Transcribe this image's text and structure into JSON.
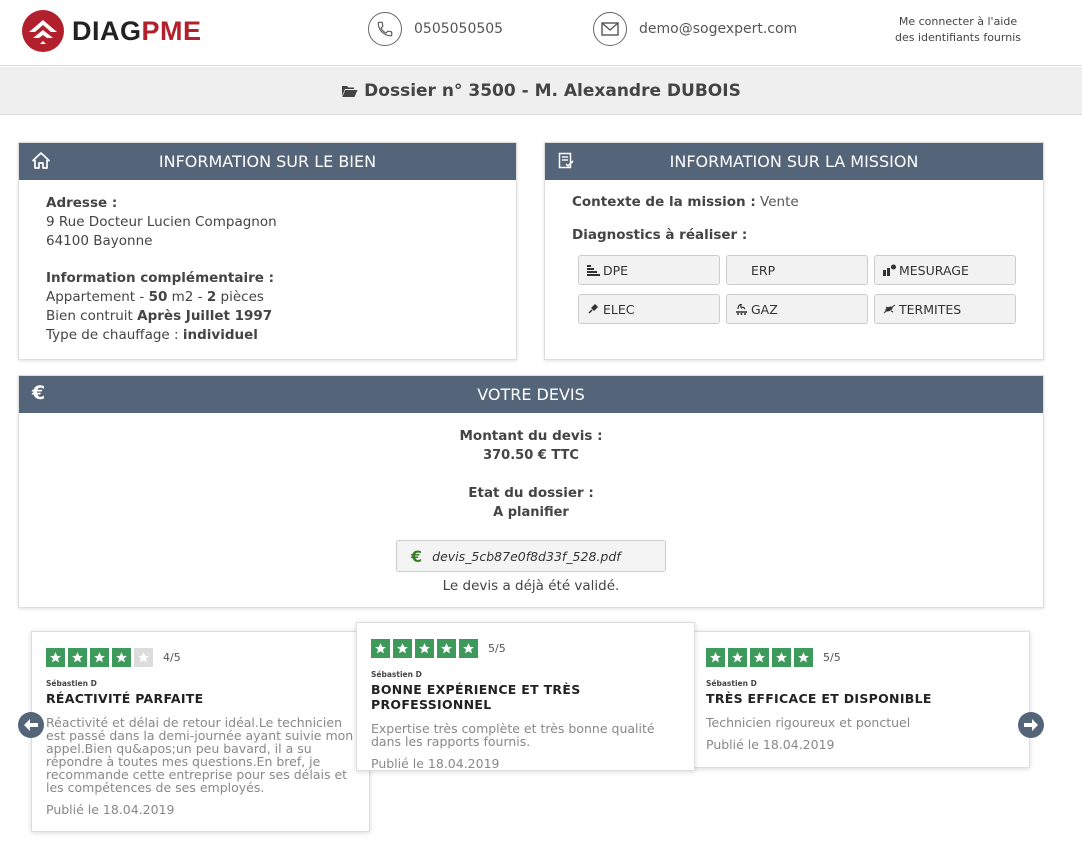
{
  "header": {
    "logo_prefix": "DIAG",
    "logo_suffix": "PME",
    "phone": "0505050505",
    "email": "demo@sogexpert.com",
    "login_line1": "Me connecter à l'aide",
    "login_line2": "des identifiants fournis"
  },
  "title": "Dossier n° 3500 - M. Alexandre DUBOIS",
  "bien": {
    "heading": "INFORMATION SUR LE BIEN",
    "address_label": "Adresse :",
    "address_line1": "9 Rue Docteur Lucien Compagnon",
    "address_line2": "64100 Bayonne",
    "extra_label": "Information complémentaire :",
    "apt_prefix": "Appartement - ",
    "surface": "50",
    "surface_unit": " m2 - ",
    "rooms": "2",
    "rooms_unit": " pièces",
    "built_prefix": "Bien contruit ",
    "built_value": "Après Juillet 1997",
    "heating_prefix": "Type de chauffage : ",
    "heating_value": "individuel"
  },
  "mission": {
    "heading": "INFORMATION SUR LA MISSION",
    "context_label": "Contexte de la mission :",
    "context_value": " Vente",
    "diag_label": "Diagnostics à réaliser :",
    "diagnostics": [
      {
        "label": "DPE",
        "icon": "dpe-icon"
      },
      {
        "label": "ERP",
        "icon": ""
      },
      {
        "label": "MESURAGE",
        "icon": "measure-icon"
      },
      {
        "label": "ELEC",
        "icon": "elec-icon"
      },
      {
        "label": "GAZ",
        "icon": "gas-icon"
      },
      {
        "label": "TERMITES",
        "icon": "termite-icon"
      }
    ]
  },
  "devis": {
    "heading": "VOTRE DEVIS",
    "amount_label": "Montant du devis :",
    "amount_value": "370.50 € TTC",
    "state_label": "Etat du dossier :",
    "state_value": "A planifier",
    "pdf_name": "devis_5cb87e0f8d33f_528.pdf",
    "validated_text": "Le devis a déjà été validé."
  },
  "reviews": [
    {
      "rating": 4,
      "score": "4/5",
      "author": "Sébastien D",
      "title": "RÉACTIVITÉ PARFAITE",
      "text": "Réactivité et délai de retour idéal.Le technicien est passé dans la demi-journée ayant suivie mon appel.Bien qu&apos;un peu bavard, il a su répondre à toutes mes questions.En bref, je recommande cette entreprise pour ses délais et les compétences de ses employés.",
      "date": "Publié le 18.04.2019"
    },
    {
      "rating": 5,
      "score": "5/5",
      "author": "Sébastien D",
      "title": "BONNE EXPÉRIENCE ET TRÈS PROFESSIONNEL",
      "text": "Expertise très complète et très bonne qualité dans les rapports fournis.",
      "date": "Publié le 18.04.2019"
    },
    {
      "rating": 5,
      "score": "5/5",
      "author": "Sébastien D",
      "title": "TRÈS EFFICACE ET DISPONIBLE",
      "text": "Technicien rigoureux et ponctuel",
      "date": "Publié le 18.04.2019"
    }
  ],
  "colors": {
    "panel_header": "#546479",
    "star_on": "#3d9a5a",
    "brand_red": "#b21f2d"
  }
}
